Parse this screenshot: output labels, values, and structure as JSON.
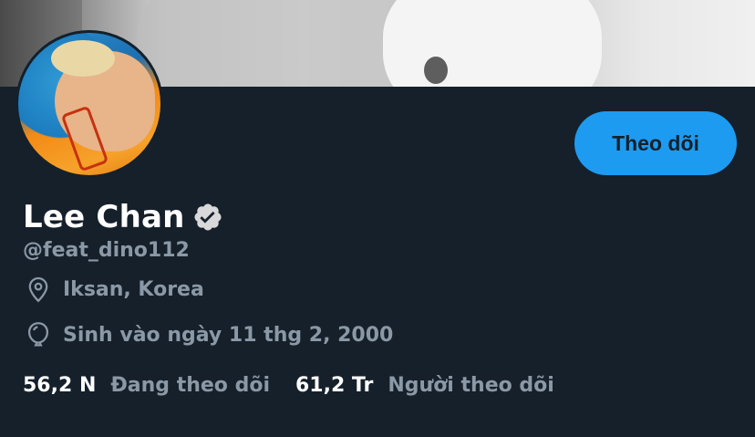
{
  "profile": {
    "display_name": "Lee Chan",
    "verified": true,
    "handle": "@feat_dino112",
    "location": "Iksan, Korea",
    "birthday": "Sinh vào ngày 11 thg 2, 2000",
    "follow_label": "Theo dõi"
  },
  "stats": {
    "following_count": "56,2 N",
    "following_label": "Đang theo dõi",
    "followers_count": "61,2 Tr",
    "followers_label": "Người theo dõi"
  },
  "icons": {
    "location": "map-pin-icon",
    "birthday": "balloon-icon",
    "verified": "verified-badge-icon"
  },
  "colors": {
    "background": "#15202b",
    "accent": "#1d9bf0",
    "secondary_text": "#8b98a5",
    "primary_text": "#ffffff"
  }
}
